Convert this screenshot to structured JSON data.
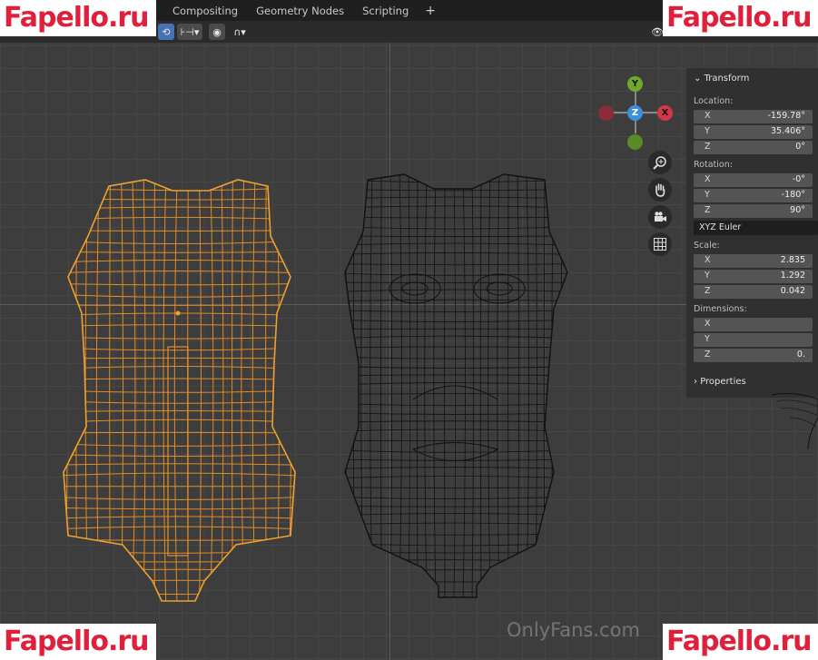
{
  "workspace_tabs": [
    "Compositing",
    "Geometry Nodes",
    "Scripting"
  ],
  "add_tab_label": "+",
  "watermarks": {
    "top_left": "Fapello.ru",
    "top_right": "Fapello.ru",
    "bottom_left": "Fapello.ru",
    "bottom_right": "Fapello.ru",
    "center_bottom": "OnlyFans.com"
  },
  "gizmo": {
    "y": "Y",
    "z": "Z",
    "x": "X"
  },
  "colors": {
    "selection_orange": "#e8902a",
    "wire_dark": "#151515",
    "gizmo_y": "#6fa82e",
    "gizmo_z": "#3b8fdb",
    "gizmo_x": "#d4364a",
    "watermark_red": "#e0203a"
  },
  "nav_icons": [
    "zoom-icon",
    "hand-icon",
    "camera-icon",
    "grid-icon"
  ],
  "panel": {
    "transform_title": "Transform",
    "location_label": "Location:",
    "location": [
      {
        "axis": "X",
        "value": "-159.78°"
      },
      {
        "axis": "Y",
        "value": "35.406°"
      },
      {
        "axis": "Z",
        "value": "0°"
      }
    ],
    "rotation_label": "Rotation:",
    "rotation": [
      {
        "axis": "X",
        "value": "-0°"
      },
      {
        "axis": "Y",
        "value": "-180°"
      },
      {
        "axis": "Z",
        "value": "90°"
      }
    ],
    "rotation_mode": "XYZ Euler",
    "scale_label": "Scale:",
    "scale": [
      {
        "axis": "X",
        "value": "2.835"
      },
      {
        "axis": "Y",
        "value": "1.292"
      },
      {
        "axis": "Z",
        "value": "0.042"
      }
    ],
    "dimensions_label": "Dimensions:",
    "dimensions": [
      {
        "axis": "X",
        "value": ""
      },
      {
        "axis": "Y",
        "value": ""
      },
      {
        "axis": "Z",
        "value": "0."
      }
    ],
    "properties_title": "Properties"
  }
}
